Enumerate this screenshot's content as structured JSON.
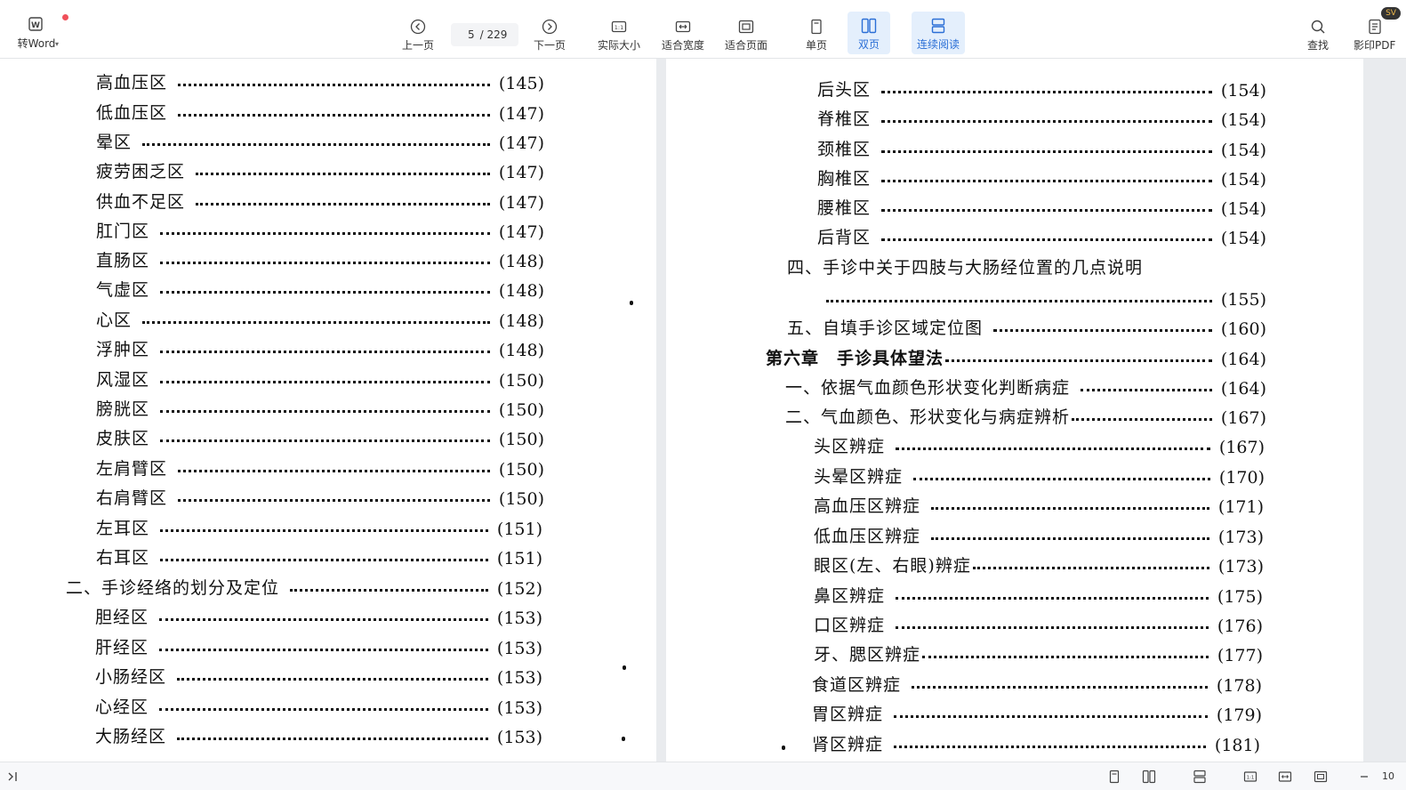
{
  "toolbar": {
    "to_word": "转Word",
    "prev_page": "上一页",
    "page_current": "5",
    "page_total": "/ 229",
    "next_page": "下一页",
    "actual_size": "实际大小",
    "fit_width": "适合宽度",
    "fit_page": "适合页面",
    "single_page": "单页",
    "double_page": "双页",
    "continuous_read": "连续阅读",
    "find": "查找",
    "print_pdf": "影印PDF",
    "avatar_text": "SV"
  },
  "left_page": {
    "entries": [
      {
        "title": "高血压区",
        "page": "(145)"
      },
      {
        "title": "低血压区",
        "page": "(147)"
      },
      {
        "title": "晕区",
        "page": "(147)"
      },
      {
        "title": "疲劳困乏区",
        "page": "(147)"
      },
      {
        "title": "供血不足区",
        "page": "(147)"
      },
      {
        "title": "肛门区",
        "page": "(147)"
      },
      {
        "title": "直肠区",
        "page": "(148)"
      },
      {
        "title": "气虚区",
        "page": "(148)"
      },
      {
        "title": "心区",
        "page": "(148)"
      },
      {
        "title": "浮肿区",
        "page": "(148)"
      },
      {
        "title": "风湿区",
        "page": "(150)"
      },
      {
        "title": "膀胱区",
        "page": "(150)"
      },
      {
        "title": "皮肤区",
        "page": "(150)"
      },
      {
        "title": "左肩臂区",
        "page": "(150)"
      },
      {
        "title": "右肩臂区",
        "page": "(150)"
      },
      {
        "title": "左耳区",
        "page": "(151)"
      },
      {
        "title": "右耳区",
        "page": "(151)"
      },
      {
        "title": "二、手诊经络的划分及定位",
        "page": "(152)"
      },
      {
        "title": "胆经区",
        "page": "(153)"
      },
      {
        "title": "肝经区",
        "page": "(153)"
      },
      {
        "title": "小肠经区",
        "page": "(153)"
      },
      {
        "title": "心经区",
        "page": "(153)"
      },
      {
        "title": "大肠经区",
        "page": "(153)"
      }
    ]
  },
  "right_page": {
    "entries": [
      {
        "title": "后头区",
        "page": "(154)"
      },
      {
        "title": "脊椎区",
        "page": "(154)"
      },
      {
        "title": "颈椎区",
        "page": "(154)"
      },
      {
        "title": "胸椎区",
        "page": "(154)"
      },
      {
        "title": "腰椎区",
        "page": "(154)"
      },
      {
        "title": "后背区",
        "page": "(154)"
      },
      {
        "title": "四、手诊中关于四肢与大肠经位置的几点说明",
        "page": ""
      },
      {
        "title": "",
        "page": "(155)"
      },
      {
        "title": "五、自填手诊区域定位图",
        "page": "(160)"
      },
      {
        "title": "第六章　手诊具体望法",
        "page": "(164)"
      },
      {
        "title": "一、依据气血颜色形状变化判断病症",
        "page": "(164)"
      },
      {
        "title": "二、气血颜色、形状变化与病症辨析",
        "page": "(167)"
      },
      {
        "title": "头区辨症",
        "page": "(167)"
      },
      {
        "title": "头晕区辨症",
        "page": "(170)"
      },
      {
        "title": "高血压区辨症",
        "page": "(171)"
      },
      {
        "title": "低血压区辨症",
        "page": "(173)"
      },
      {
        "title": "眼区(左、右眼)辨症",
        "page": "(173)"
      },
      {
        "title": "鼻区辨症",
        "page": "(175)"
      },
      {
        "title": "口区辨症",
        "page": "(176)"
      },
      {
        "title": "牙、腮区辨症",
        "page": "(177)"
      },
      {
        "title": "食道区辨症",
        "page": "(178)"
      },
      {
        "title": "胃区辨症",
        "page": "(179)"
      },
      {
        "title": "肾区辨症",
        "page": "(181)"
      }
    ]
  },
  "statusbar": {
    "zoom": "10"
  },
  "colors": {
    "accent": "#2b6fd6",
    "active_bg": "#e4effc",
    "background": "#e9ebee"
  }
}
